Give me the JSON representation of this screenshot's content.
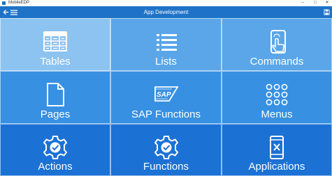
{
  "window": {
    "title": "MobileEDP",
    "minimize": "–",
    "maximize": "□",
    "close": "✕"
  },
  "appbar": {
    "title": "App Development",
    "back_icon": "back-arrow-icon",
    "menu_icon": "hamburger-menu-icon",
    "save_icon": "save-icon"
  },
  "tiles": [
    {
      "label": "Tables",
      "icon": "table-icon",
      "color": "#8cc3f0"
    },
    {
      "label": "Lists",
      "icon": "list-icon",
      "color": "#5aa6e8"
    },
    {
      "label": "Commands",
      "icon": "touch-phone-icon",
      "color": "#5aa6e8"
    },
    {
      "label": "Pages",
      "icon": "page-icon",
      "color": "#3790e2"
    },
    {
      "label": "SAP Functions",
      "icon": "sap-logo-icon",
      "color": "#3790e2"
    },
    {
      "label": "Menus",
      "icon": "grid-dots-icon",
      "color": "#3790e2"
    },
    {
      "label": "Actions",
      "icon": "gear-check-icon",
      "color": "#1c72d4"
    },
    {
      "label": "Functions",
      "icon": "gear-check-icon",
      "color": "#1c72d4"
    },
    {
      "label": "Applications",
      "icon": "phone-x-icon",
      "color": "#1c72d4"
    }
  ]
}
